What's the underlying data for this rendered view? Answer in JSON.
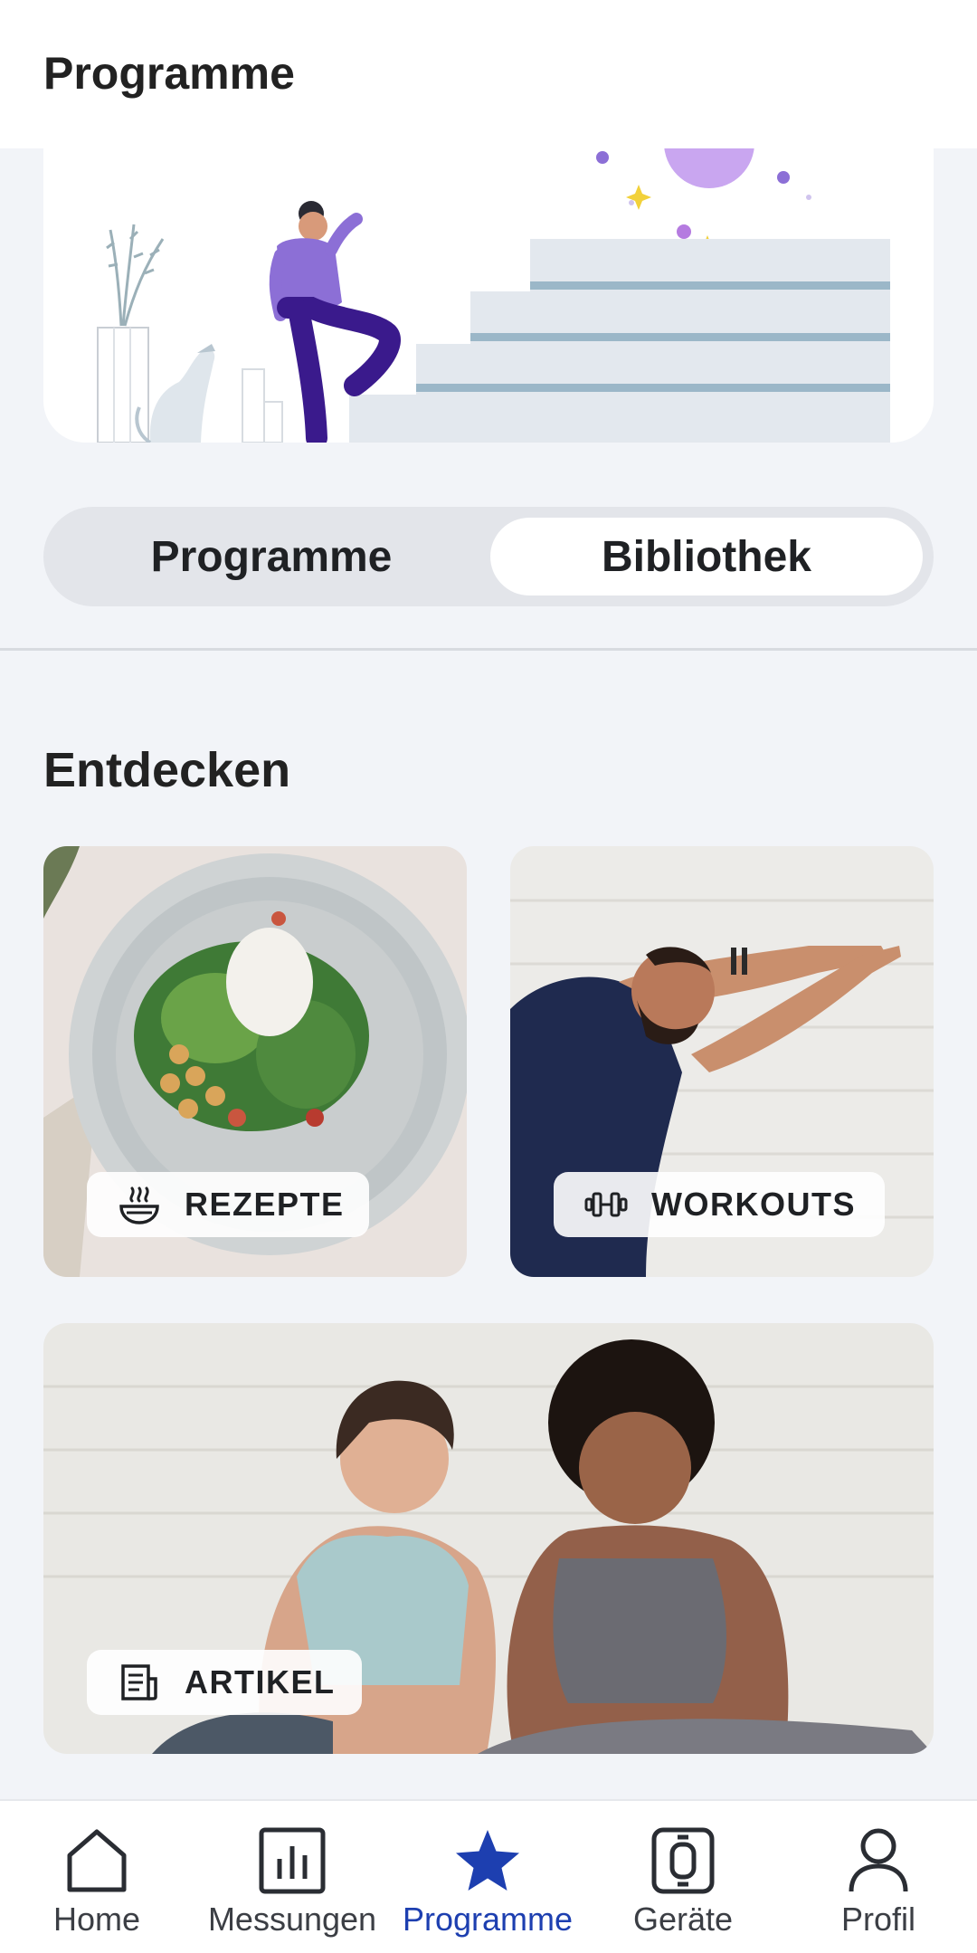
{
  "header": {
    "title": "Programme"
  },
  "segmented": {
    "left": "Programme",
    "right": "Bibliothek",
    "selected": "Bibliothek"
  },
  "discover": {
    "title": "Entdecken",
    "cards": [
      {
        "label": "REZEPTE",
        "icon": "bowl-steam-icon"
      },
      {
        "label": "WORKOUTS",
        "icon": "dumbbell-icon"
      },
      {
        "label": "ARTIKEL",
        "icon": "article-icon"
      }
    ]
  },
  "tabbar": {
    "items": [
      {
        "label": "Home",
        "icon": "home-icon"
      },
      {
        "label": "Messungen",
        "icon": "bar-chart-icon"
      },
      {
        "label": "Programme",
        "icon": "star-icon"
      },
      {
        "label": "Geräte",
        "icon": "watch-icon"
      },
      {
        "label": "Profil",
        "icon": "person-icon"
      }
    ],
    "active": "Programme"
  },
  "colors": {
    "accent": "#1d3fb0",
    "background": "#f2f4f8",
    "hero_purple": "#8c6fd6",
    "hero_indigo": "#3a1a8c"
  }
}
